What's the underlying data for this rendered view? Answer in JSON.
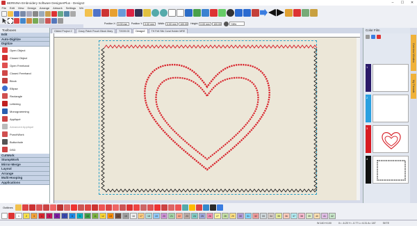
{
  "window": {
    "title": "BERNINA Embroidery Software DesignerPlus - Design2"
  },
  "menu": [
    "File",
    "Edit",
    "View",
    "Design",
    "Arrange",
    "Artwork",
    "Settings",
    "Window",
    "Help"
  ],
  "toolbar_row2": {
    "pos_x_label": "Position X:",
    "pos_y_label": "Position Y:",
    "pos_x": "0.00 mm",
    "pos_y": "0.00 mm",
    "width_label": "Width:",
    "height_label": "Height:",
    "width": "0.00 mm",
    "height": "0.00 mm",
    "pct_w": "100.00",
    "pct_h": "100.00",
    "zoom": "78%"
  },
  "toolbox": {
    "title": "Toolboxes",
    "sections_top": [
      "Edit",
      "Auto-Digitize",
      "Digitize"
    ],
    "tools": [
      {
        "label": "Open Object",
        "color": "#e04040"
      },
      {
        "label": "Closed Object",
        "color": "#d03030"
      },
      {
        "label": "Open Freehand",
        "color": "#e05050"
      },
      {
        "label": "Closed Freehand",
        "color": "#d04848"
      },
      {
        "label": "Block",
        "color": "#c04040"
      },
      {
        "label": "Ellipse",
        "color": "#3d6fd0"
      },
      {
        "label": "Rectangle",
        "color": "#d05050"
      },
      {
        "label": "Lettering",
        "color": "#c02020"
      },
      {
        "label": "Monogramming",
        "color": "#2a5fb0"
      },
      {
        "label": "Appliqué",
        "color": "#c44"
      },
      {
        "label": "Advanced Appliqué",
        "color": "#bbb",
        "dim": true
      },
      {
        "label": "PunchWork",
        "color": "#d05050"
      },
      {
        "label": "Buttonhole",
        "color": "#555"
      },
      {
        "label": "DSD",
        "color": "#c44"
      }
    ],
    "sections_bottom": [
      "CutWork",
      "StumpWork",
      "Mirror-Merge",
      "Layout",
      "Arrange",
      "Multi-Hooping",
      "Applications"
    ]
  },
  "tabs": [
    "Gilded Project 2",
    "Crazy Patch Pouch Block Mary",
    "T2039.03",
    "Design2",
    "TH Felt Silk Coral Holder MRE"
  ],
  "active_tab": "Design2",
  "color_film": {
    "title": "Color Film",
    "rows": [
      {
        "num": "1",
        "color": "#2a1a6a"
      },
      {
        "num": "2",
        "color": "#2aa0e0"
      },
      {
        "num": "3",
        "color": "#d81c24"
      },
      {
        "num": "4",
        "color": "#111111"
      }
    ]
  },
  "side_tabs": [
    "Overview Window",
    "My Threads"
  ],
  "bottom_left_label": "Outlines",
  "bottom_chips": [
    "1",
    "2",
    "3",
    "4",
    "5",
    "6",
    "7",
    "8",
    "9",
    "10",
    "11",
    "12",
    "13",
    "14",
    "15",
    "16",
    "17",
    "18",
    "19",
    "20",
    "21",
    "22",
    "23",
    "24",
    "25",
    "26",
    "27",
    "28",
    "29",
    "30",
    "31",
    "32",
    "33",
    "34",
    "35",
    "36",
    "37",
    "38",
    "39",
    "40",
    "41",
    "42"
  ],
  "status": {
    "stitch": "W:140 H:100",
    "coords": "X= -6.25 Y= -0.77 L= 6.31 A= 187",
    "right": "SKTE"
  },
  "colors": {
    "heart_red": "#d8262e",
    "accent_blue": "#2aa0c8",
    "fabric": "#ece7d8"
  }
}
